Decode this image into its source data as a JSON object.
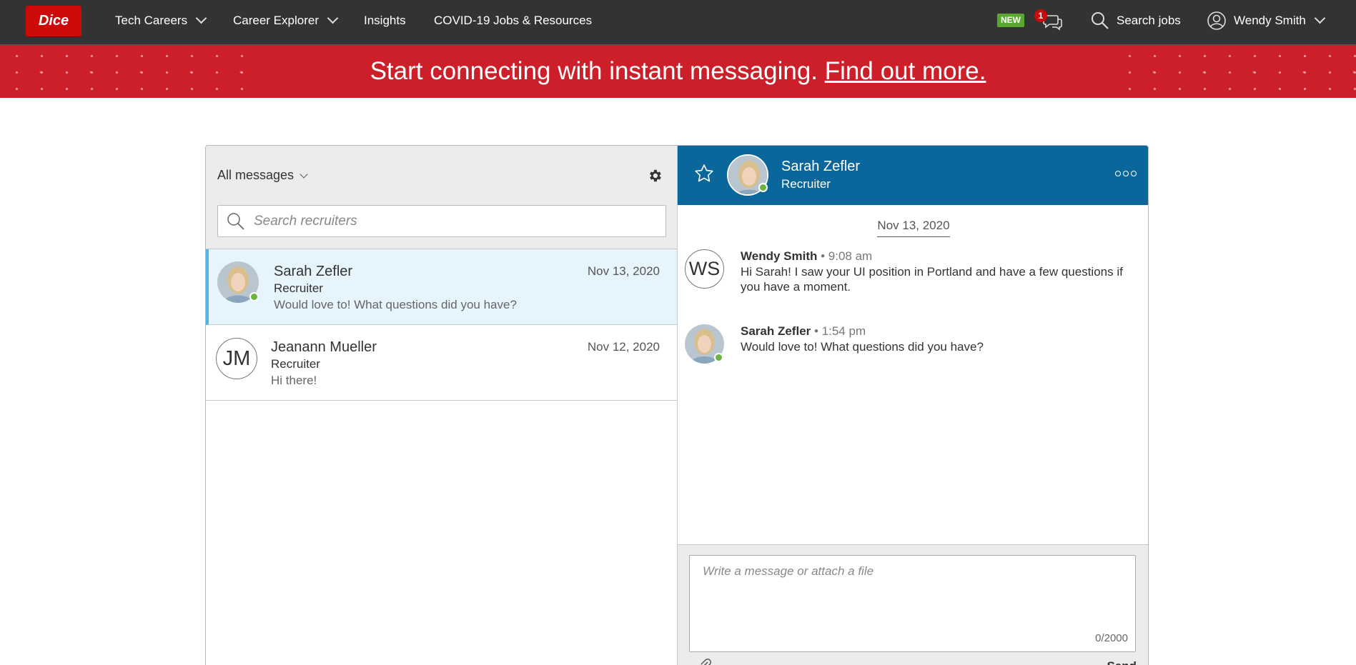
{
  "nav": {
    "logo": "Dice",
    "items": [
      {
        "label": "Tech Careers",
        "dropdown": true
      },
      {
        "label": "Career Explorer",
        "dropdown": true
      },
      {
        "label": "Insights",
        "dropdown": false
      },
      {
        "label": "COVID-19 Jobs & Resources",
        "dropdown": false
      }
    ],
    "new_badge": "NEW",
    "message_count": "1",
    "search_jobs": "Search jobs",
    "user_name": "Wendy Smith"
  },
  "banner": {
    "text": "Start connecting with instant messaging.",
    "link": "Find out more.",
    "color": "#cc1f2a"
  },
  "inbox": {
    "filter_label": "All messages",
    "search_placeholder": "Search recruiters",
    "conversations": [
      {
        "name": "Sarah Zefler",
        "role": "Recruiter",
        "preview": "Would love to! What questions did you have?",
        "date": "Nov 13, 2020",
        "avatar": "photo",
        "online": true,
        "active": true
      },
      {
        "name": "Jeanann Mueller",
        "role": "Recruiter",
        "preview": "Hi there!",
        "date": "Nov 12, 2020",
        "initials": "JM",
        "online": false,
        "active": false
      }
    ]
  },
  "chat": {
    "header": {
      "name": "Sarah Zefler",
      "role": "Recruiter",
      "accent": "#0a679c"
    },
    "date_divider": "Nov 13, 2020",
    "messages": [
      {
        "sender": "Wendy Smith",
        "time": "• 9:08 am",
        "initials": "WS",
        "text": "Hi Sarah! I saw your UI position in Portland and have a few questions if you have a moment."
      },
      {
        "sender": "Sarah Zefler",
        "time": "• 1:54 pm",
        "avatar": "photo",
        "online": true,
        "text": "Would love to! What questions did you have?"
      }
    ],
    "composer": {
      "placeholder": "Write a message or attach a file",
      "char_count": "0/2000",
      "send_label": "Send"
    }
  }
}
